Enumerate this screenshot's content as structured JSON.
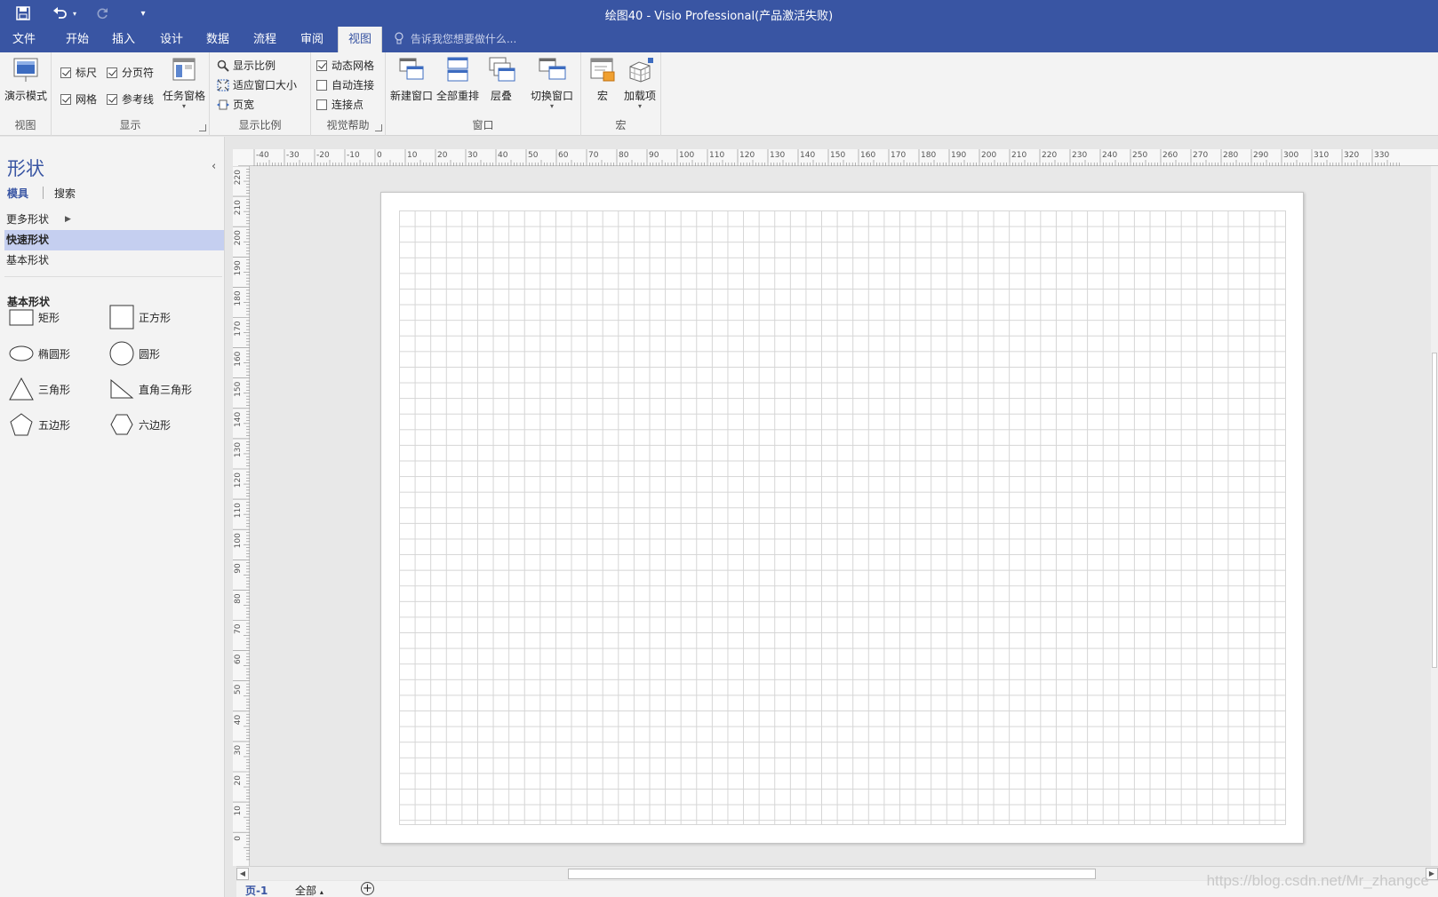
{
  "window": {
    "title": "绘图40 - Visio Professional(产品激活失败)"
  },
  "quick_access": {
    "save_icon": "save-icon",
    "undo_icon": "undo-icon",
    "redo_icon": "redo-icon",
    "customize_icon": "customize-icon"
  },
  "tabs": [
    {
      "label": "文件"
    },
    {
      "label": "开始"
    },
    {
      "label": "插入"
    },
    {
      "label": "设计"
    },
    {
      "label": "数据"
    },
    {
      "label": "流程"
    },
    {
      "label": "审阅"
    },
    {
      "label": "视图"
    }
  ],
  "active_tab": "视图",
  "tell_me": {
    "placeholder": "告诉我您想要做什么..."
  },
  "ribbon": {
    "view_group": {
      "label": "视图",
      "presentation_mode": "演示模式"
    },
    "show_group": {
      "label": "显示",
      "ruler": {
        "label": "标尺",
        "checked": true
      },
      "page_breaks": {
        "label": "分页符",
        "checked": true
      },
      "grid": {
        "label": "网格",
        "checked": true
      },
      "guides": {
        "label": "参考线",
        "checked": true
      },
      "task_panes": "任务窗格"
    },
    "zoom_group": {
      "label": "显示比例",
      "zoom": "显示比例",
      "fit_to_window": "适应窗口大小",
      "page_width": "页宽"
    },
    "visual_aids_group": {
      "label": "视觉帮助",
      "dynamic_grid": {
        "label": "动态网格",
        "checked": true
      },
      "auto_connect": {
        "label": "自动连接",
        "checked": false
      },
      "connection_points": {
        "label": "连接点",
        "checked": false
      }
    },
    "window_group": {
      "label": "窗口",
      "new_window": "新建窗口",
      "arrange_all": "全部重排",
      "cascade": "层叠",
      "switch_windows": "切换窗口"
    },
    "macros_group": {
      "label": "宏",
      "macros": "宏",
      "add_ins": "加载项"
    }
  },
  "shapes_pane": {
    "title": "形状",
    "tabs": [
      "模具",
      "搜索"
    ],
    "stencils": [
      {
        "label": "更多形状"
      },
      {
        "label": "快速形状"
      },
      {
        "label": "基本形状"
      }
    ],
    "section_title": "基本形状",
    "shapes": [
      {
        "label": "矩形"
      },
      {
        "label": "正方形"
      },
      {
        "label": "椭圆形"
      },
      {
        "label": "圆形"
      },
      {
        "label": "三角形"
      },
      {
        "label": "直角三角形"
      },
      {
        "label": "五边形"
      },
      {
        "label": "六边形"
      }
    ]
  },
  "rulers": {
    "horizontal": [
      "-40",
      "-30",
      "-20",
      "-10",
      "0",
      "10",
      "20",
      "30",
      "40",
      "50",
      "60",
      "70",
      "80",
      "90",
      "100",
      "110",
      "120",
      "130",
      "140",
      "150",
      "160",
      "170",
      "180",
      "190",
      "200",
      "210",
      "220",
      "230",
      "240",
      "250",
      "260",
      "270",
      "280",
      "290",
      "300",
      "310",
      "320",
      "330"
    ],
    "vertical": [
      "220",
      "210",
      "200",
      "190",
      "180",
      "170",
      "160",
      "150",
      "140",
      "130",
      "120",
      "110",
      "100",
      "90",
      "80",
      "70",
      "60",
      "50",
      "40",
      "30",
      "20",
      "10",
      "0"
    ]
  },
  "page_tabs": {
    "current": "页-1",
    "all": "全部"
  },
  "watermark": "https://blog.csdn.net/Mr_zhangce"
}
